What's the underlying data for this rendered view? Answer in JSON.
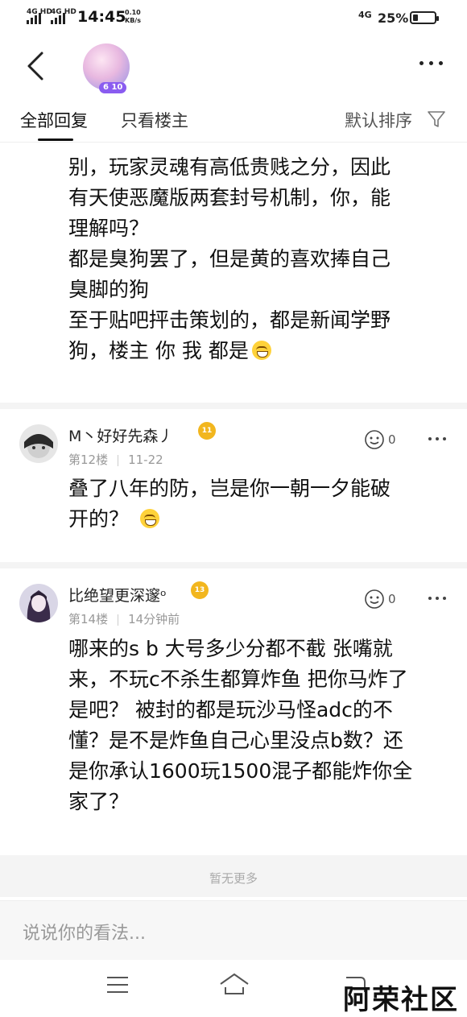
{
  "status_bar": {
    "signal1": "4G HD",
    "signal2": "4G HD",
    "time": "14:45",
    "speed_value": "0.10",
    "speed_unit": "KB/s",
    "network": "4G",
    "battery_percent": "25%",
    "battery_level": 0.25
  },
  "nav": {
    "avatar_level": "6 10",
    "back_icon": "chevron-left-icon",
    "more_icon": "more-horizontal-icon"
  },
  "tabs": {
    "all": "全部回复",
    "host_only": "只看楼主",
    "sort": "默认排序",
    "filter_icon": "funnel-icon"
  },
  "post_top": {
    "lines": [
      "别，玩家灵魂有高低贵贱之分，因此",
      "有天使恶魔版两套封号机制，你，能",
      "理解吗？",
      "都是臭狗罢了，但是黄的喜欢捧自己",
      "臭脚的狗",
      "至于贴吧抨击策划的，都是新闻学野",
      "狗，楼主 你 我 都是"
    ]
  },
  "comments": [
    {
      "username": "M丶好好先森丿",
      "level_badge": "11",
      "floor": "第12楼",
      "time": "11-22",
      "likes": "0",
      "lines": [
        "叠了八年的防，岂是你一朝一夕能破",
        "开的？"
      ]
    },
    {
      "username": "比绝望更深邃ᵒ",
      "level_badge": "13",
      "floor": "第14楼",
      "time": "14分钟前",
      "likes": "0",
      "lines": [
        "哪来的s b 大号多少分都不截 张嘴就",
        "来，不玩c不杀生都算炸鱼 把你马炸了",
        "是吧？ 被封的都是玩沙马怪adc的不",
        "懂？是不是炸鱼自己心里没点b数？还",
        "是你承认1600玩1500混子都能炸你全",
        "家了？"
      ]
    }
  ],
  "footer": {
    "no_more": "暂无更多",
    "input_placeholder": "说说你的看法..."
  },
  "system_nav": {
    "menu_icon": "menu-icon",
    "home_icon": "home-icon",
    "back_icon": "back-icon"
  },
  "watermark": "阿荣社区"
}
